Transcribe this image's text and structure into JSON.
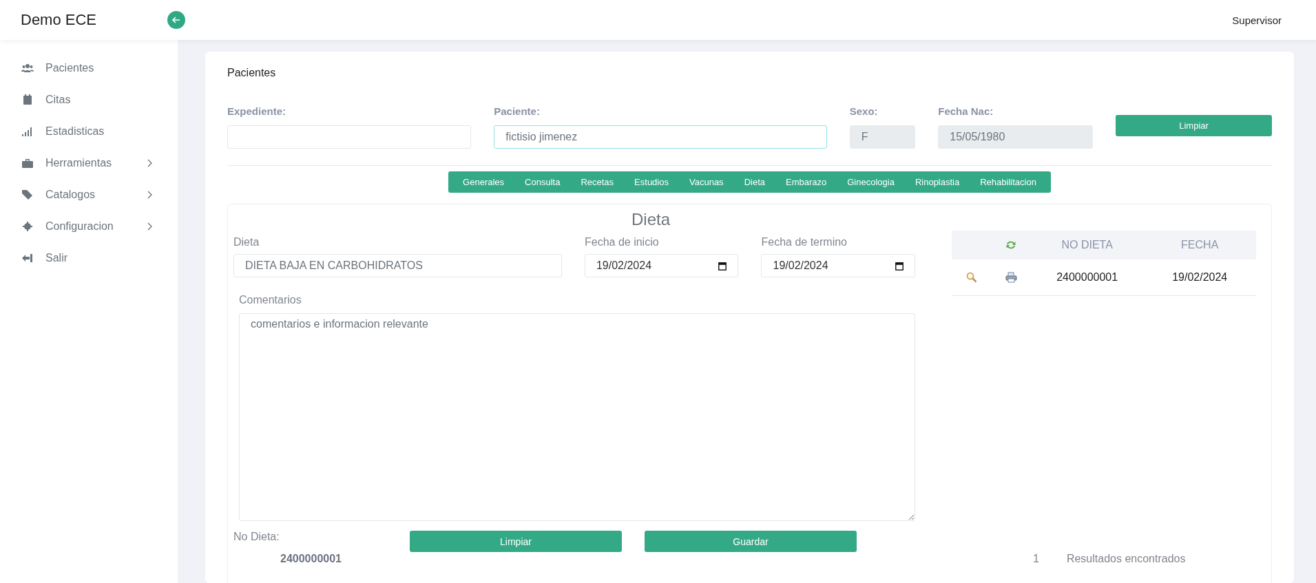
{
  "app": {
    "title": "Demo ECE",
    "user": "Supervisor"
  },
  "sidebar": {
    "items": [
      {
        "label": "Pacientes",
        "expandable": false
      },
      {
        "label": "Citas",
        "expandable": false
      },
      {
        "label": "Estadisticas",
        "expandable": false
      },
      {
        "label": "Herramientas",
        "expandable": true
      },
      {
        "label": "Catalogos",
        "expandable": true
      },
      {
        "label": "Configuracion",
        "expandable": true
      },
      {
        "label": "Salir",
        "expandable": false
      }
    ]
  },
  "page": {
    "title": "Pacientes",
    "patient": {
      "fields": [
        {
          "label": "Expediente:",
          "readonly": false,
          "focused": false
        },
        {
          "label": "Paciente:",
          "value": "fictisio jimenez",
          "readonly": false,
          "focused": true
        },
        {
          "label": "Sexo:",
          "value": "F",
          "readonly": true,
          "focused": false
        },
        {
          "label": "Fecha Nac:",
          "value": "15/05/1980",
          "readonly": true,
          "focused": false
        }
      ],
      "button": "Limpiar"
    },
    "tabs": [
      "Generales",
      "Consulta",
      "Recetas",
      "Estudios",
      "Vacunas",
      "Dieta",
      "Embarazo",
      "Ginecologia",
      "Rinoplastia",
      "Rehabilitacion"
    ],
    "diet": {
      "title": "Dieta",
      "fields": [
        {
          "label": "Dieta",
          "value": "DIETA BAJA EN CARBOHIDRATOS",
          "kind": "text"
        },
        {
          "label": "Fecha de inicio",
          "value": "19/02/2024",
          "kind": "date"
        },
        {
          "label": "Fecha de termino",
          "value": "19/02/2024",
          "kind": "date"
        }
      ],
      "comments": {
        "label": "Comentarios",
        "value": "comentarios e informacion relevante"
      },
      "number": {
        "label": "No Dieta:",
        "value": "2400000001"
      },
      "buttons": [
        "Limpiar",
        "Guardar"
      ],
      "table": {
        "columns": [
          "NO DIETA",
          "FECHA"
        ],
        "rows": [
          {
            "no": "2400000001",
            "fecha": "19/02/2024"
          }
        ],
        "count": "1",
        "count_label": "Resultados encontrados"
      }
    }
  }
}
